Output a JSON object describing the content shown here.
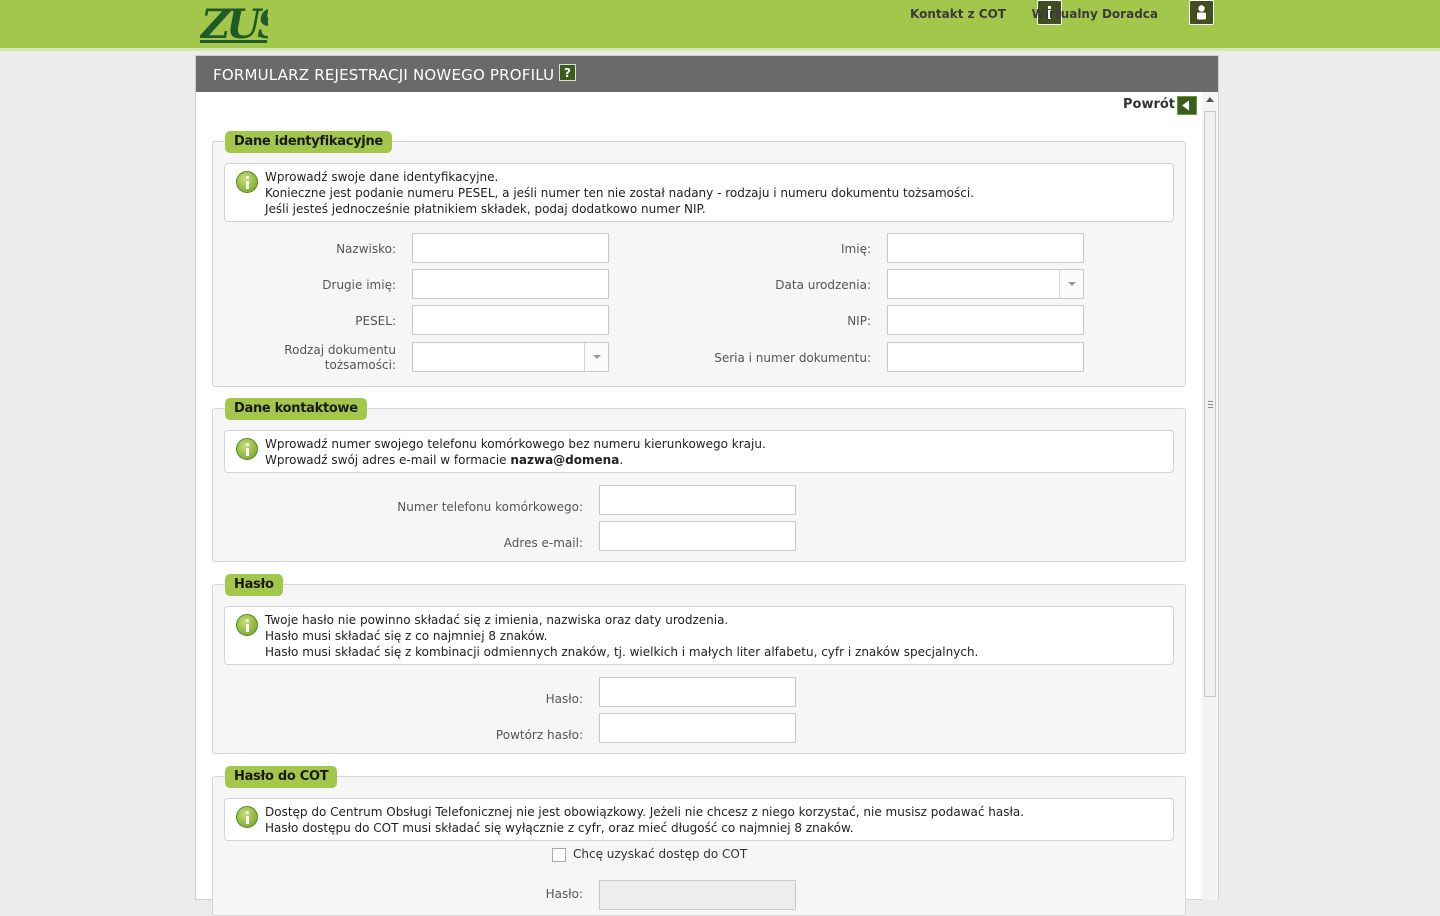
{
  "topbar": {
    "logo_text": "ZUS",
    "contact_label": "Kontakt z COT",
    "advisor_label": "Wirtualny Doradca",
    "contact_icon": "info-icon",
    "advisor_icon": "user-icon"
  },
  "panel": {
    "title": "FORMULARZ REJESTRACJI NOWEGO PROFILU",
    "help_label": "?",
    "back_label": "Powrót"
  },
  "identification": {
    "legend": "Dane identyfikacyjne",
    "info_lines": [
      "Wprowadź swoje dane identyfikacyjne.",
      "Konieczne jest podanie numeru PESEL, a jeśli numer ten nie został nadany - rodzaju i numeru dokumentu tożsamości.",
      "Jeśli jesteś jednocześnie płatnikiem składek, podaj dodatkowo numer NIP."
    ],
    "fields": {
      "surname": {
        "label": "Nazwisko:",
        "value": ""
      },
      "first_name": {
        "label": "Imię:",
        "value": ""
      },
      "second_name": {
        "label": "Drugie imię:",
        "value": ""
      },
      "birth_date": {
        "label": "Data urodzenia:",
        "value": ""
      },
      "pesel": {
        "label": "PESEL:",
        "value": ""
      },
      "nip": {
        "label": "NIP:",
        "value": ""
      },
      "doc_type_l1": "Rodzaj dokumentu",
      "doc_type_l2": "tożsamości:",
      "doc_number": {
        "label": "Seria i numer dokumentu:",
        "value": ""
      }
    }
  },
  "contact": {
    "legend": "Dane kontaktowe",
    "info_line1": "Wprowadź numer swojego telefonu komórkowego bez numeru kierunkowego kraju.",
    "info_line2_prefix": "Wprowadź swój adres e-mail w formacie ",
    "info_line2_bold": "nazwa@domena",
    "info_line2_suffix": ".",
    "phone_label": "Numer telefonu komórkowego:",
    "email_label": "Adres e-mail:"
  },
  "password": {
    "legend": "Hasło",
    "info_lines": [
      "Twoje hasło nie powinno składać się z imienia, nazwiska oraz daty urodzenia.",
      "Hasło musi składać się z co najmniej 8 znaków.",
      "Hasło musi składać się z kombinacji odmiennych znaków, tj. wielkich i małych liter alfabetu, cyfr i znaków specjalnych."
    ],
    "password_label": "Hasło:",
    "repeat_label": "Powtórz hasło:"
  },
  "cot": {
    "legend": "Hasło do COT",
    "info_lines": [
      "Dostęp do Centrum Obsługi Telefonicznej nie jest obowiązkowy. Jeżeli nie chcesz z niego korzystać, nie musisz podawać hasła.",
      "Hasło dostępu do COT musi składać się wyłącznie z cyfr, oraz mieć długość co najmniej 8 znaków."
    ],
    "checkbox_label": "Chcę uzyskać dostęp do COT",
    "password_label": "Hasło:"
  },
  "colors": {
    "brand_green": "#a3c74a",
    "dark_green": "#3c5d1d",
    "header_gray": "#6a6a6a"
  }
}
